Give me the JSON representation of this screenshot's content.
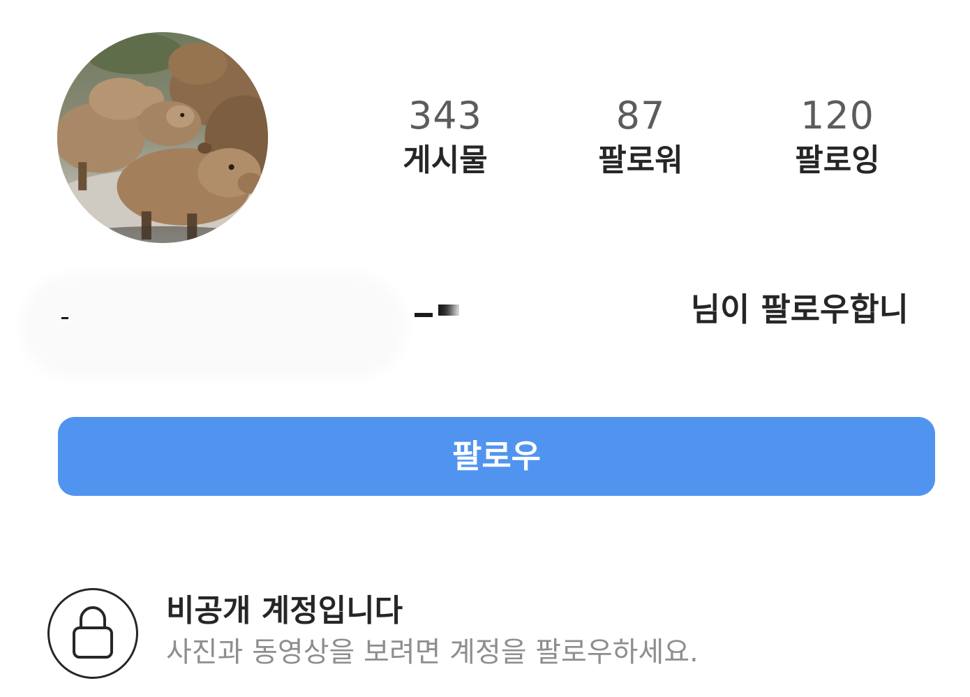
{
  "stats": {
    "posts": {
      "count": "343",
      "label": "게시물"
    },
    "followers": {
      "count": "87",
      "label": "팔로워"
    },
    "following": {
      "count": "120",
      "label": "팔로잉"
    }
  },
  "followed_by": {
    "visible_text": "님이 팔로우합니"
  },
  "follow_button": {
    "label": "팔로우",
    "color": "#5094f0"
  },
  "private_account": {
    "icon": "lock-icon",
    "title": "비공개 계정입니다",
    "description": "사진과 동영상을 보려면 계정을 팔로우하세요."
  }
}
